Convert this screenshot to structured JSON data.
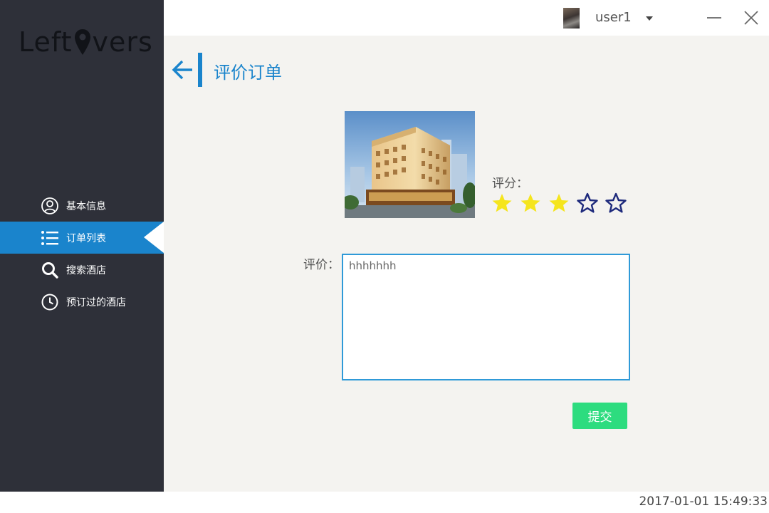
{
  "app": {
    "logo_before": "Left",
    "logo_after": "vers"
  },
  "sidebar": {
    "items": [
      {
        "label": "基本信息",
        "icon": "user-circle-icon",
        "active": false
      },
      {
        "label": "订单列表",
        "icon": "list-icon",
        "active": true
      },
      {
        "label": "搜索酒店",
        "icon": "search-icon",
        "active": false
      },
      {
        "label": "预订过的酒店",
        "icon": "clock-icon",
        "active": false
      }
    ]
  },
  "topbar": {
    "username": "user1"
  },
  "page": {
    "title": "评价订单"
  },
  "review": {
    "rating_label": "评分：",
    "rating": 3,
    "max_rating": 5,
    "comment_label": "评价：",
    "comment_value": "hhhhhhh",
    "submit_label": "提交"
  },
  "status": {
    "timestamp": "2017-01-01 15:49:33"
  },
  "colors": {
    "accent": "#1a84cc",
    "star_filled": "#f5e51d",
    "star_outline": "#1e2a7c",
    "submit": "#2ddc7f"
  }
}
